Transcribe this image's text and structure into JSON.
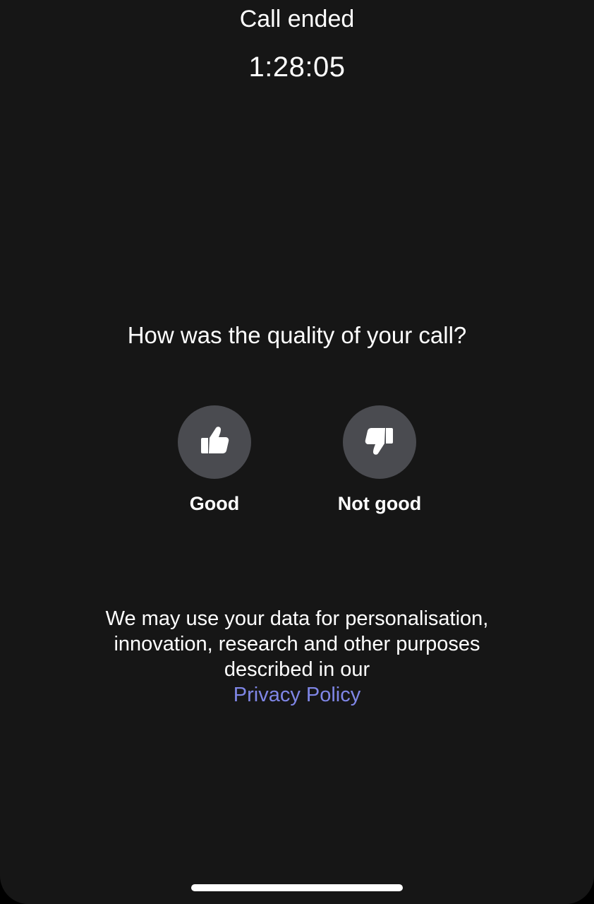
{
  "call": {
    "status": "Call ended",
    "duration": "1:28:05"
  },
  "feedback": {
    "question": "How was the quality of your call?",
    "options": [
      {
        "label": "Good",
        "icon": "thumbs-up-icon"
      },
      {
        "label": "Not good",
        "icon": "thumbs-down-icon"
      }
    ]
  },
  "disclaimer": {
    "lines": [
      "We may use your data for personalisation,",
      "innovation, research and other purposes",
      "described in our"
    ],
    "link_label": "Privacy Policy"
  },
  "colors": {
    "background": "#161616",
    "button_circle": "#4a4b50",
    "link": "#7f86e6",
    "text": "#ffffff"
  }
}
